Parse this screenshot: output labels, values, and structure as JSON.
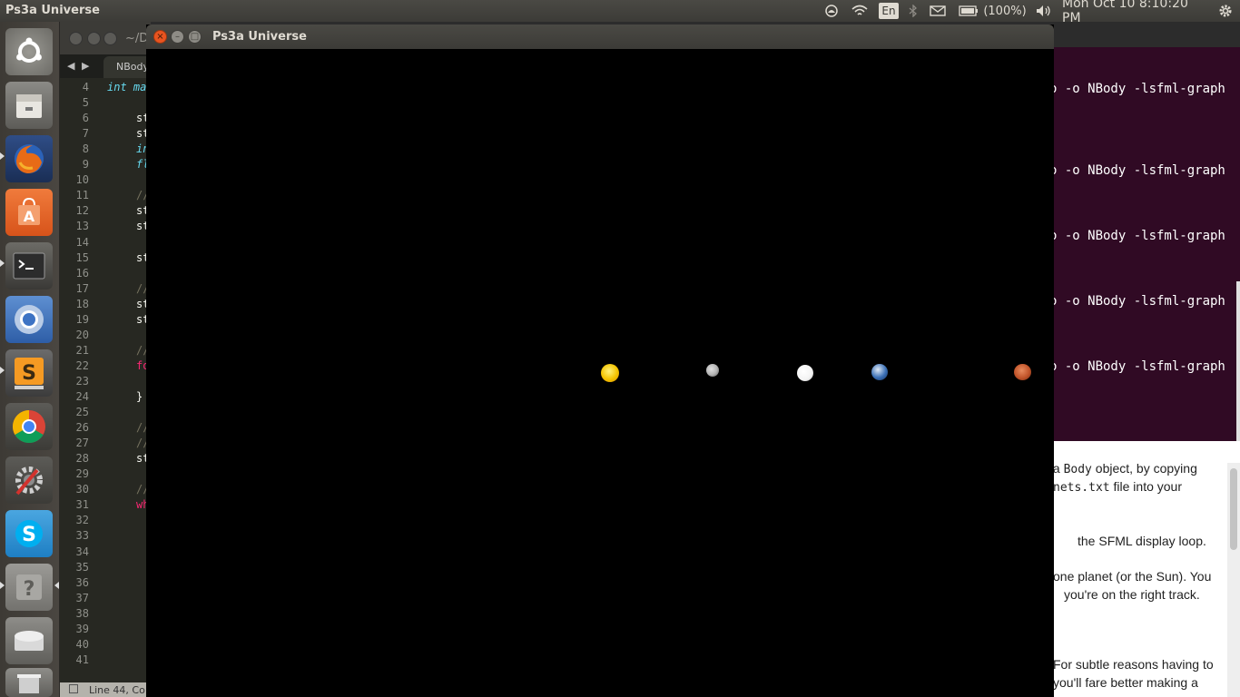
{
  "top_panel": {
    "app_title": "Ps3a Universe",
    "keyboard_layout": "En",
    "battery": "(100%)",
    "clock": "Mon Oct 10  8:10:20 PM"
  },
  "editor": {
    "title": "~/D",
    "tab": "NBody",
    "line_numbers": [
      "4",
      "5",
      "6",
      "7",
      "8",
      "9",
      "10",
      "11",
      "12",
      "13",
      "14",
      "15",
      "16",
      "17",
      "18",
      "19",
      "20",
      "21",
      "22",
      "23",
      "24",
      "25",
      "26",
      "27",
      "28",
      "29",
      "30",
      "31",
      "32",
      "33",
      "34",
      "35",
      "36",
      "37",
      "38",
      "39",
      "40",
      "41"
    ],
    "visible_code": {
      "l4": "int ma",
      "l6": "st",
      "l7": "st",
      "l8": "in",
      "l9": "fl",
      "l11": "//",
      "l12": "st",
      "l13": "st",
      "l15": "st",
      "l17": "//",
      "l18": "st",
      "l19": "st",
      "l21": "//",
      "l22": "fo",
      "l24": "}",
      "l26": "//",
      "l27": "//",
      "l28": "st",
      "l30": "//",
      "l31": "wh"
    },
    "status": "Line 44, Co"
  },
  "terminal": {
    "lines": [
      "o -o NBody -lsfml-graph",
      "o -o NBody -lsfml-graph",
      "o -o NBody -lsfml-graph",
      "o -o NBody -lsfml-graph",
      "o -o NBody -lsfml-graph"
    ]
  },
  "document": {
    "line1_pre": "s a ",
    "line1_code": "Body",
    "line1_post": " object, by copying",
    "line2_code": "nets.txt",
    "line2_post": " file into your",
    "line3": "the SFML display loop.",
    "line4": "one planet (or the Sun). You",
    "line5": " you're on the right track.",
    "line6": "For subtle reasons having to",
    "line7": "you'll fare better making a"
  },
  "window": {
    "title": "Ps3a Universe",
    "close_glyph": "×",
    "minimize_glyph": "–",
    "maximize_glyph": "□"
  },
  "colors": {
    "sun": "#f4c400",
    "mercury": "#b7b7b7",
    "venus": "#f3f3f3",
    "earth": "#3a6fb5",
    "mars": "#c1542a",
    "terminal_bg": "#300a24",
    "close_button": "#e95420"
  }
}
